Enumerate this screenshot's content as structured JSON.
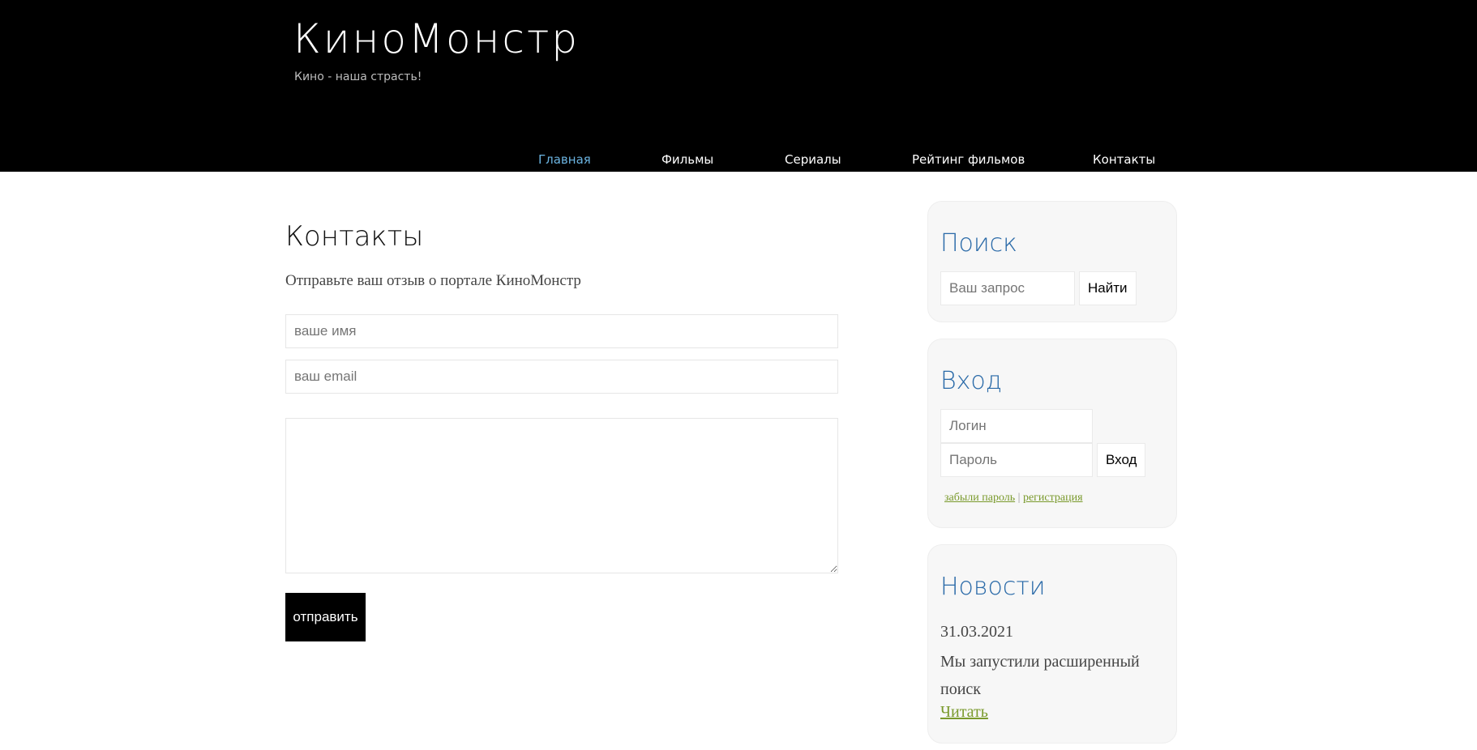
{
  "header": {
    "site_title": "КиноМонстр",
    "slogan": "Кино - наша страсть!"
  },
  "nav": {
    "items": [
      {
        "label": "Главная",
        "active": true
      },
      {
        "label": "Фильмы",
        "active": false
      },
      {
        "label": "Сериалы",
        "active": false
      },
      {
        "label": "Рейтинг фильмов",
        "active": false
      },
      {
        "label": "Контакты",
        "active": false
      }
    ]
  },
  "main": {
    "title": "Контакты",
    "intro": "Отправьте ваш отзыв о портале КиноМонстр",
    "name_placeholder": "ваше имя",
    "email_placeholder": "ваш email",
    "message_value": "",
    "submit_label": "отправить"
  },
  "sidebar": {
    "search": {
      "title": "Поиск",
      "placeholder": "Ваш запрос",
      "button_label": "Найти"
    },
    "login": {
      "title": "Вход",
      "login_placeholder": "Логин",
      "password_placeholder": "Пароль",
      "button_label": "Вход",
      "forgot_label": "забыли пароль",
      "separator": "|",
      "register_label": "регистрация"
    },
    "news": {
      "title": "Новости",
      "date": "31.03.2021",
      "text": "Мы запустили расширенный поиск",
      "read_label": "Читать"
    }
  },
  "colors": {
    "header_bg": "#000000",
    "nav_active": "#6bb3e0",
    "widget_title": "#2a6aa8",
    "link": "#7a9a2c",
    "submit_bg": "#000000"
  }
}
